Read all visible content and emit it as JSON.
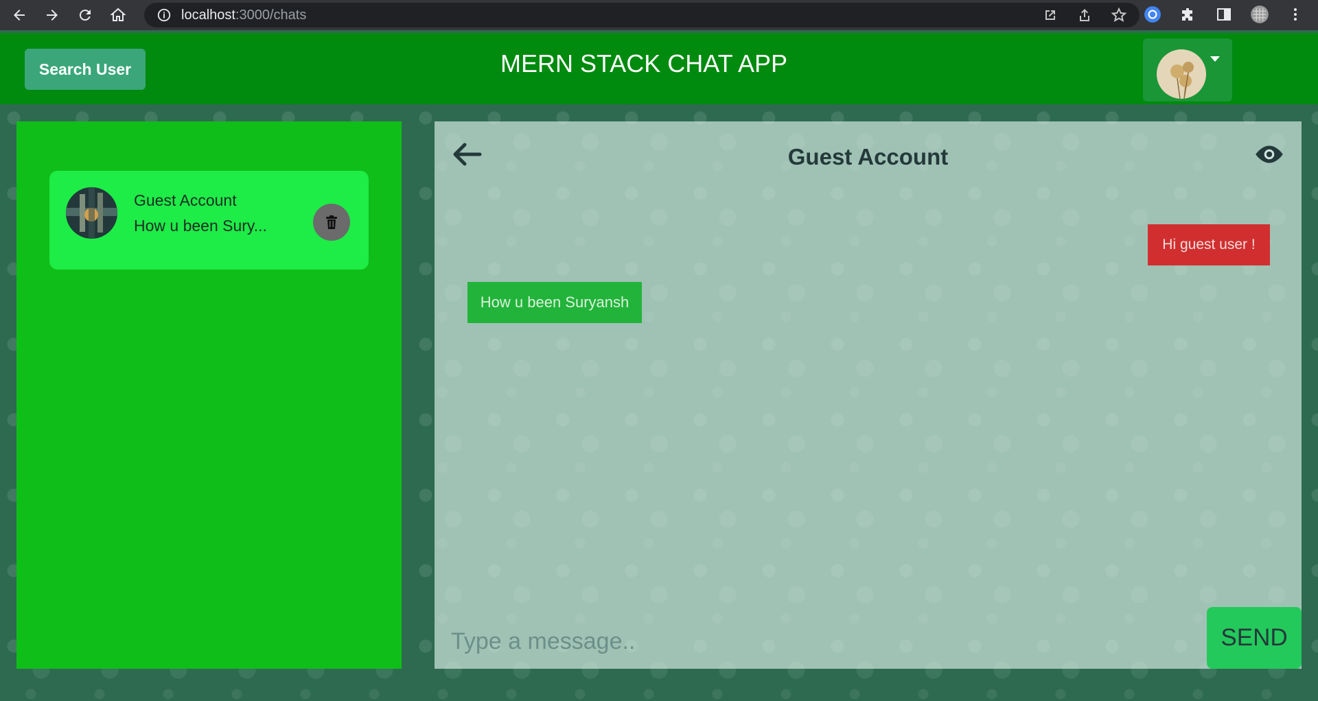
{
  "browser": {
    "url_host": "localhost",
    "url_path": ":3000/chats"
  },
  "header": {
    "search_label": "Search User",
    "title": "MERN STACK CHAT APP"
  },
  "sidebar": {
    "chats": [
      {
        "name": "Guest Account",
        "preview": "How u been Sury..."
      }
    ]
  },
  "chat": {
    "title": "Guest Account",
    "messages": [
      {
        "text": "Hi guest user !",
        "side": "right"
      },
      {
        "text": "How u been Suryansh",
        "side": "left"
      }
    ],
    "input_placeholder": "Type a message..",
    "send_label": "SEND"
  },
  "colors": {
    "header_bg": "#008a0e",
    "sidebar_bg": "#10be19",
    "chat_item_bg": "#1eec47",
    "sent_bubble": "#d12f2f",
    "received_bubble": "#22b33a",
    "send_button": "#24c95c"
  }
}
